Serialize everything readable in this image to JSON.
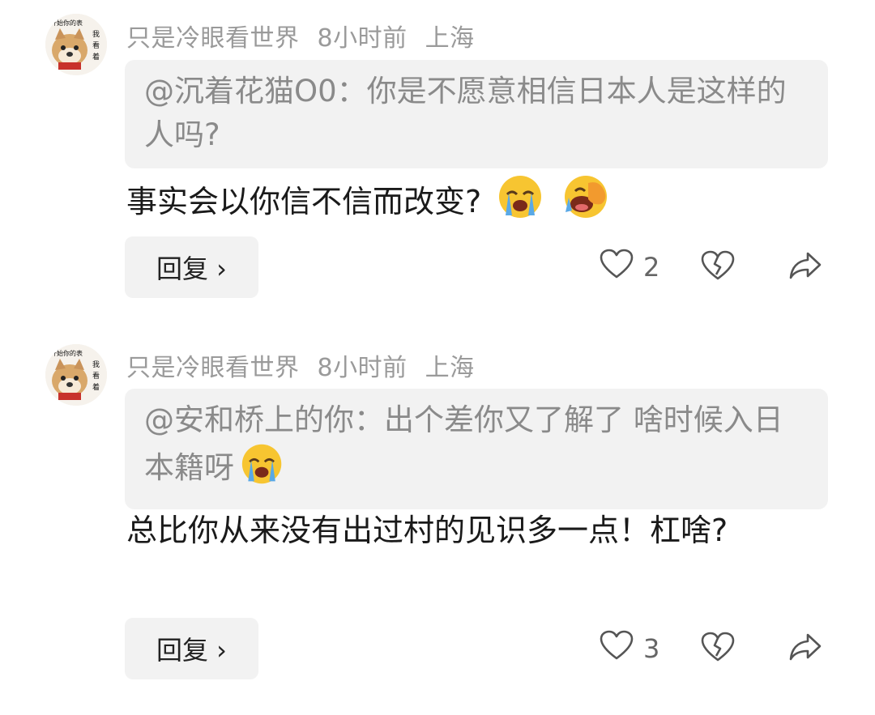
{
  "comments": [
    {
      "username": "只是冷眼看世界",
      "time": "8小时前",
      "location": "上海",
      "avatar_text": [
        "开始你的表",
        "我",
        "看",
        "着"
      ],
      "quote": "@沉着花猫O0：你是不愿意相信日本人是这样的人吗?",
      "reply": "事实会以你信不信而改变?",
      "reply_emojis": [
        "crying-face-icon",
        "laughing-cover-face-icon"
      ],
      "reply_button": "回复 ›",
      "likes": "2"
    },
    {
      "username": "只是冷眼看世界",
      "time": "8小时前",
      "location": "上海",
      "avatar_text": [
        "开始你的表",
        "我",
        "看",
        "着"
      ],
      "quote": "@安和桥上的你：出个差你又了解了 啥时候入日本籍呀",
      "quote_emojis": [
        "crying-face-icon"
      ],
      "reply": "总比你从来没有出过村的见识多一点！杠啥?",
      "reply_button": "回复 ›",
      "likes": "3"
    }
  ]
}
